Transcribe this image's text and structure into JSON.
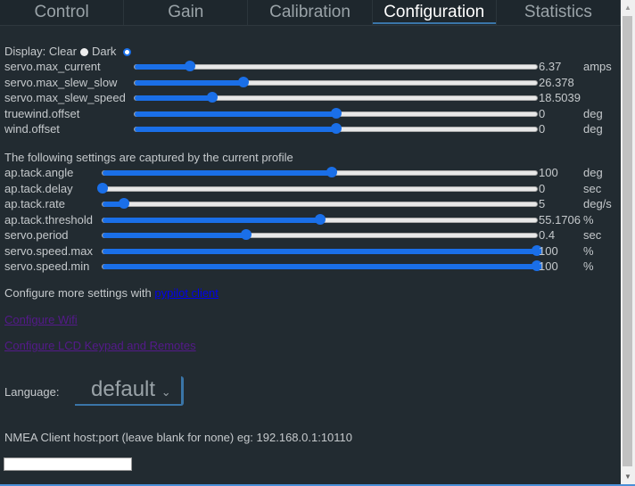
{
  "tabs": [
    {
      "label": "Control"
    },
    {
      "label": "Gain"
    },
    {
      "label": "Calibration"
    },
    {
      "label": "Configuration",
      "active": true
    },
    {
      "label": "Statistics"
    }
  ],
  "display": {
    "label": "Display:",
    "clear": "Clear",
    "dark": "Dark",
    "selected": "Dark"
  },
  "settings": [
    {
      "name": "servo.max_current",
      "value": "6.37",
      "unit": "amps",
      "fraction": 0.137
    },
    {
      "name": "servo.max_slew_slow",
      "value": "26.378",
      "unit": "",
      "fraction": 0.27
    },
    {
      "name": "servo.max_slew_speed",
      "value": "18.5039",
      "unit": "",
      "fraction": 0.194
    },
    {
      "name": "truewind.offset",
      "value": "0",
      "unit": "deg",
      "fraction": 0.5
    },
    {
      "name": "wind.offset",
      "value": "0",
      "unit": "deg",
      "fraction": 0.5
    }
  ],
  "profile_heading": "The following settings are captured by the current profile",
  "profile_settings": [
    {
      "name": "ap.tack.angle",
      "value": "100",
      "unit": "deg",
      "fraction": 0.528
    },
    {
      "name": "ap.tack.delay",
      "value": "0",
      "unit": "sec",
      "fraction": 0.0
    },
    {
      "name": "ap.tack.rate",
      "value": "5",
      "unit": "deg/s",
      "fraction": 0.05
    },
    {
      "name": "ap.tack.threshold",
      "value": "55.1706",
      "unit": "%",
      "fraction": 0.5
    },
    {
      "name": "servo.period",
      "value": "0.4",
      "unit": "sec",
      "fraction": 0.33
    },
    {
      "name": "servo.speed.max",
      "value": "100",
      "unit": "%",
      "fraction": 1.0
    },
    {
      "name": "servo.speed.min",
      "value": "100",
      "unit": "%",
      "fraction": 1.0
    }
  ],
  "more_settings": {
    "text": "Configure more settings with ",
    "link": "pypilot client"
  },
  "links": {
    "wifi": "Configure Wifi",
    "lcd": "Configure LCD Keypad and Remotes"
  },
  "language": {
    "label": "Language:",
    "value": "default"
  },
  "nmea": {
    "label": "NMEA Client host:port (leave blank for none) eg: 192.168.0.1:10110",
    "value": ""
  },
  "colors": {
    "accent": "#1a6fe8",
    "background": "#222b31",
    "link": "#0000ee",
    "visited": "#551a8b"
  }
}
